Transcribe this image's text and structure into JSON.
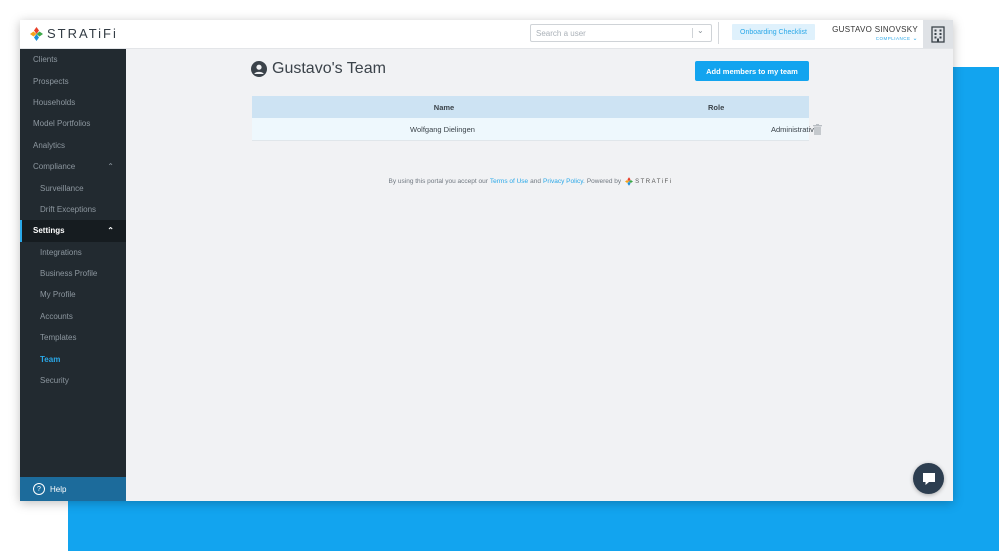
{
  "brand": {
    "name": "STRATiFi"
  },
  "header": {
    "search_placeholder": "Search a user",
    "onboarding_label": "Onboarding Checklist",
    "user_name": "GUSTAVO SINOVSKY",
    "user_role": "COMPLIANCE"
  },
  "sidebar": {
    "items": [
      {
        "label": "Clients"
      },
      {
        "label": "Prospects"
      },
      {
        "label": "Households"
      },
      {
        "label": "Model Portfolios"
      },
      {
        "label": "Analytics"
      },
      {
        "label": "Compliance"
      },
      {
        "label": "Surveillance"
      },
      {
        "label": "Drift Exceptions"
      },
      {
        "label": "Settings"
      },
      {
        "label": "Integrations"
      },
      {
        "label": "Business Profile"
      },
      {
        "label": "My Profile"
      },
      {
        "label": "Accounts"
      },
      {
        "label": "Templates"
      },
      {
        "label": "Team"
      },
      {
        "label": "Security"
      }
    ],
    "help_label": "Help"
  },
  "page": {
    "title": "Gustavo's Team",
    "add_button_label": "Add members to my team"
  },
  "table": {
    "columns": [
      "Name",
      "Role"
    ],
    "rows": [
      {
        "name": "Wolfgang Dielingen",
        "role": "Administrative"
      }
    ]
  },
  "footer": {
    "prefix": "By using this portal you accept our",
    "terms": "Terms of Use",
    "and": "and",
    "privacy": "Privacy Policy.",
    "powered": "Powered by",
    "brand": "STRATiFi"
  },
  "colors": {
    "accent": "#12a4ef",
    "sidebar_bg": "#222a30",
    "help_bg": "#1c6b9b",
    "table_header_bg": "#cde3f3"
  }
}
